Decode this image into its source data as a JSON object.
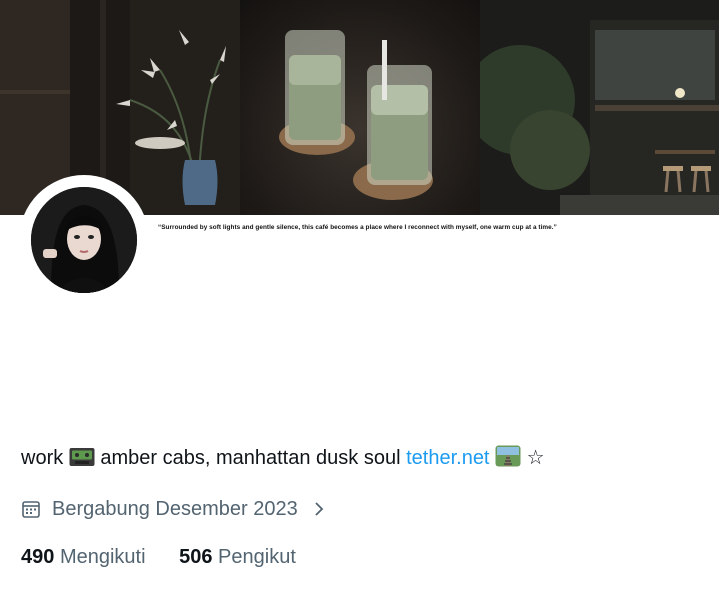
{
  "banner": {
    "caption": "“Surrounded by soft lights and gentle silence, this café becomes a place where I reconnect with myself, one warm cup at a time.”"
  },
  "profile": {
    "bio": {
      "text": "work",
      "emoji1": "cassette-emoji",
      "text2": "amber cabs, manhattan dusk soul",
      "link": "tether.net",
      "emoji2": "railway-track-emoji",
      "star": "☆"
    },
    "joined": {
      "icon": "calendar-icon",
      "label": "Bergabung Desember 2023",
      "chevron": "chevron-right-icon"
    },
    "stats": {
      "following_count": "490",
      "following_label": "Mengikuti",
      "followers_count": "506",
      "followers_label": "Pengikut"
    }
  },
  "colors": {
    "text": "#0f1419",
    "muted": "#536471",
    "link": "#1d9bf0"
  }
}
